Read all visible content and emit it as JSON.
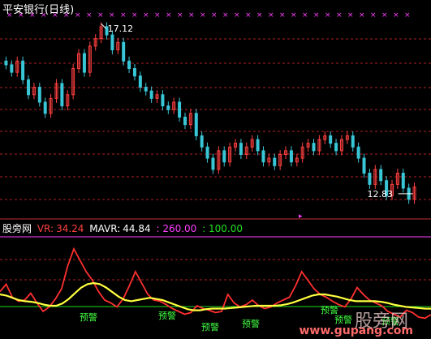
{
  "window": {
    "title": "平安银行(日线)"
  },
  "watermark": {
    "logo_text": "股旁网",
    "url_text": "www.gupang.com"
  },
  "indicator": {
    "name": "股旁网",
    "vr_label": "VR:",
    "vr_value": "34.24",
    "mavr_label": "MAVR:",
    "mavr_value": "44.84",
    "level_a": ": 260.00",
    "level_b": ": 100.00"
  },
  "colors": {
    "up": "#ff4040",
    "down": "#39c6d6",
    "grid": "#b02020",
    "vr": "#ff3030",
    "mavr": "#ffff40",
    "level_a": "#ff40ff",
    "level_b": "#20e020",
    "marker": "#ff40ff",
    "warning_text": "#40ff40"
  },
  "chart_data": [
    {
      "type": "line",
      "title": "平安银行(日线)",
      "series": [
        {
          "kind": "candlestick-close",
          "values": [
            16.1,
            15.9,
            16.2,
            15.7,
            15.3,
            15.5,
            15.1,
            14.8,
            15.2,
            15.6,
            15.0,
            15.3,
            16.0,
            16.4,
            15.9,
            16.6,
            16.8,
            17.12,
            16.9,
            16.5,
            16.7,
            16.2,
            16.0,
            15.8,
            15.5,
            15.4,
            15.2,
            15.3,
            15.0,
            14.9,
            15.1,
            14.7,
            14.5,
            14.8,
            14.2,
            13.9,
            13.6,
            13.3,
            13.8,
            13.5,
            13.9,
            14.0,
            13.7,
            13.9,
            14.1,
            13.8,
            13.5,
            13.6,
            13.4,
            13.7,
            13.8,
            13.5,
            13.6,
            13.9,
            14.0,
            13.8,
            14.1,
            14.2,
            14.0,
            13.8,
            14.1,
            14.2,
            13.9,
            13.6,
            13.2,
            12.9,
            13.3,
            13.0,
            12.6,
            12.9,
            13.2,
            12.8,
            12.5,
            12.83
          ]
        }
      ],
      "annotations": [
        "17.12",
        "12.83"
      ],
      "marker_count_top": 36
    },
    {
      "type": "line",
      "series": [
        {
          "name": "VR",
          "values": [
            75,
            88,
            65,
            58,
            60,
            72,
            55,
            40,
            48,
            62,
            80,
            120,
            150,
            130,
            110,
            95,
            75,
            60,
            55,
            48,
            62,
            85,
            110,
            90,
            70,
            60,
            58,
            52,
            45,
            40,
            35,
            38,
            50,
            45,
            42,
            38,
            40,
            70,
            55,
            48,
            52,
            60,
            50,
            45,
            48,
            55,
            60,
            65,
            85,
            110,
            95,
            80,
            70,
            65,
            58,
            52,
            48,
            62,
            82,
            70,
            60,
            55,
            50,
            40,
            35,
            30,
            42,
            38,
            30,
            28,
            34.24
          ]
        },
        {
          "name": "MAVR",
          "values": [
            70,
            68,
            64,
            60,
            58,
            57,
            55,
            52,
            50,
            50,
            54,
            62,
            72,
            82,
            88,
            90,
            88,
            82,
            74,
            66,
            60,
            58,
            60,
            62,
            64,
            62,
            60,
            56,
            52,
            48,
            44,
            42,
            42,
            44,
            45,
            45,
            45,
            46,
            47,
            48,
            49,
            50,
            50,
            50,
            50,
            51,
            53,
            56,
            60,
            64,
            68,
            70,
            70,
            68,
            66,
            63,
            60,
            58,
            58,
            58,
            58,
            57,
            55,
            52,
            50,
            48,
            47,
            46,
            45,
            44.84
          ]
        }
      ],
      "levels": [
        260,
        100
      ],
      "annotations": [
        "预警"
      ]
    }
  ]
}
